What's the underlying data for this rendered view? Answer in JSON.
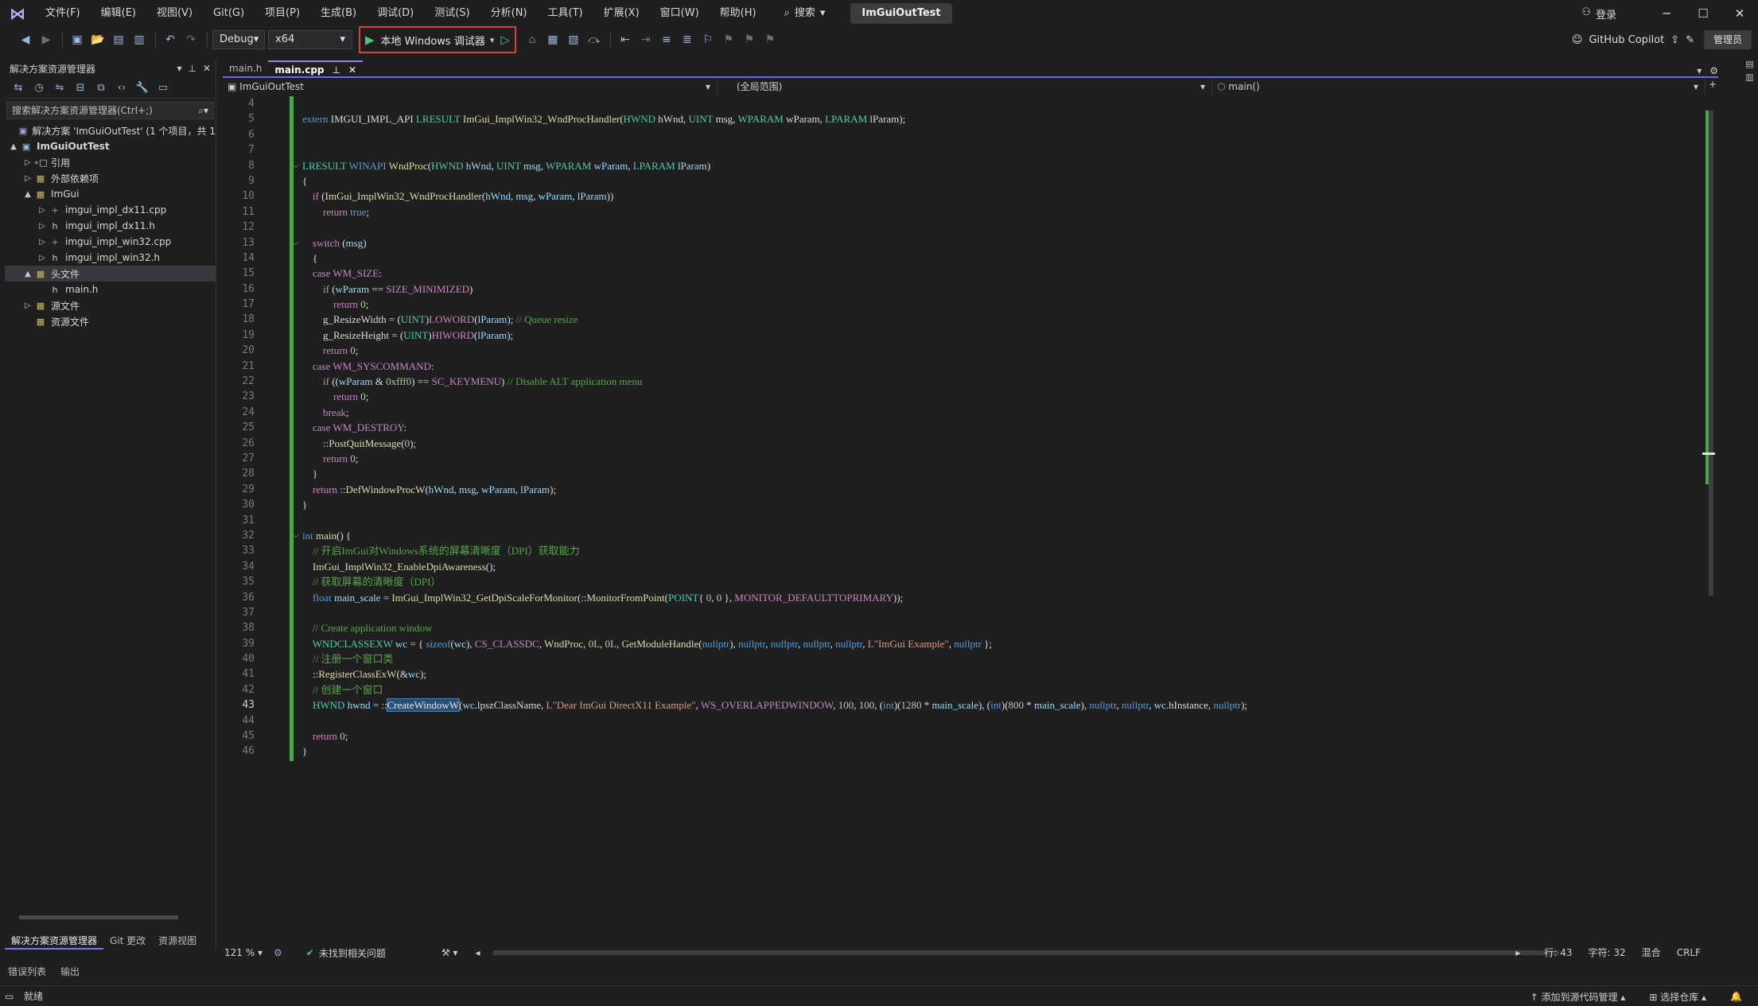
{
  "menu": {
    "items": [
      "文件(F)",
      "编辑(E)",
      "视图(V)",
      "Git(G)",
      "项目(P)",
      "生成(B)",
      "调试(D)",
      "测试(S)",
      "分析(N)",
      "工具(T)",
      "扩展(X)",
      "窗口(W)",
      "帮助(H)"
    ],
    "search_label": "搜索",
    "solution_title": "ImGuiOutTest",
    "login_label": "登录"
  },
  "toolbar": {
    "config": "Debug",
    "platform": "x64",
    "run_label": "本地 Windows 调试器",
    "copilot_label": "GitHub Copilot",
    "admin_label": "管理员"
  },
  "solution_explorer": {
    "title": "解决方案资源管理器",
    "search_placeholder": "搜索解决方案资源管理器(Ctrl+;)",
    "tree": [
      {
        "label": "解决方案 'ImGuiOutTest' (1 个项目，共 1",
        "depth": 0,
        "arrow": "",
        "icon": "solution-icon"
      },
      {
        "label": "ImGuiOutTest",
        "depth": 0,
        "arrow": "▲",
        "icon": "project-icon",
        "bold": true
      },
      {
        "label": "引用",
        "depth": 1,
        "arrow": "▷",
        "icon": "references-icon"
      },
      {
        "label": "外部依赖项",
        "depth": 1,
        "arrow": "▷",
        "icon": "filter-icon"
      },
      {
        "label": "ImGui",
        "depth": 1,
        "arrow": "▲",
        "icon": "filter-icon"
      },
      {
        "label": "imgui_impl_dx11.cpp",
        "depth": 2,
        "arrow": "▷",
        "icon": "cpp-file-icon"
      },
      {
        "label": "imgui_impl_dx11.h",
        "depth": 2,
        "arrow": "▷",
        "icon": "header-file-icon"
      },
      {
        "label": "imgui_impl_win32.cpp",
        "depth": 2,
        "arrow": "▷",
        "icon": "cpp-file-icon"
      },
      {
        "label": "imgui_impl_win32.h",
        "depth": 2,
        "arrow": "▷",
        "icon": "header-file-icon"
      },
      {
        "label": "头文件",
        "depth": 1,
        "arrow": "▲",
        "icon": "filter-icon",
        "selected": true
      },
      {
        "label": "main.h",
        "depth": 2,
        "arrow": "",
        "icon": "header-file-icon"
      },
      {
        "label": "源文件",
        "depth": 1,
        "arrow": "▷",
        "icon": "filter-icon"
      },
      {
        "label": "资源文件",
        "depth": 1,
        "arrow": "",
        "icon": "filter-icon"
      }
    ],
    "bottom_tabs": [
      "解决方案资源管理器",
      "Git 更改",
      "资源视图"
    ]
  },
  "editor": {
    "tabs": [
      "main.h",
      "main.cpp"
    ],
    "active_tab": "main.cpp",
    "nav_project": "ImGuiOutTest",
    "nav_scope": "(全局范围)",
    "nav_member": "main()",
    "first_line": 4,
    "current_line": 43,
    "zoom": "121 %",
    "issues": "未找到相关问题",
    "position_line": "行: 43",
    "position_char": "字符: 32",
    "whitespace": "混合",
    "line_ending": "CRLF"
  },
  "output_tabs": [
    "错误列表",
    "输出"
  ],
  "statusbar": {
    "ready": "就绪",
    "add_source_control": "添加到源代码管理",
    "select_repo": "选择仓库"
  },
  "colors": {
    "accent": "#6b6bd6",
    "run_highlight_border": "#e03a3a",
    "change_bar": "#4aa84a"
  }
}
